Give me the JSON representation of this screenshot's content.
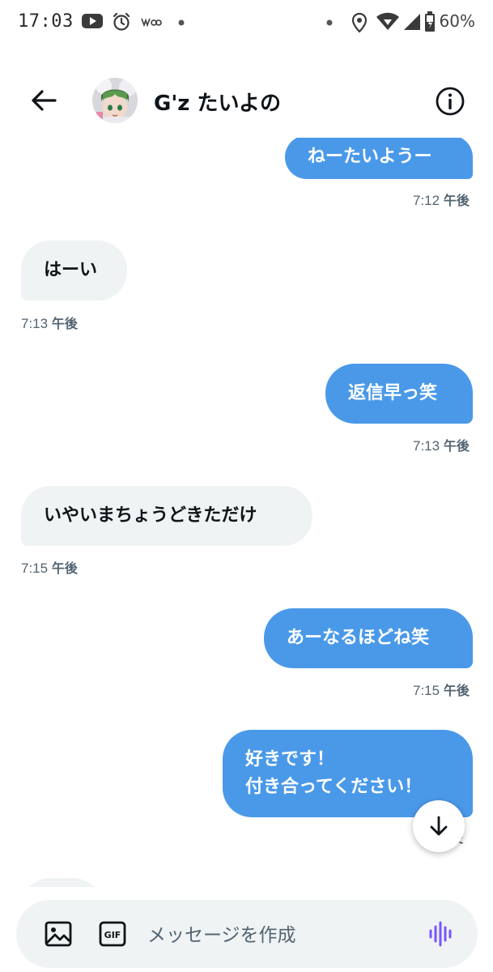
{
  "status_bar": {
    "time": "17:03",
    "battery": "60%",
    "icons": [
      "youtube-icon",
      "alarm-icon",
      "whoo-icon",
      "dot-icon",
      "dot-icon",
      "location-icon",
      "wifi-icon",
      "signal-icon",
      "battery-icon"
    ]
  },
  "header": {
    "name": "G'z たいよの",
    "back_icon": "arrow-left-icon",
    "info_icon": "info-circle-icon"
  },
  "messages": [
    {
      "direction": "sent",
      "text": "ねーたいようー",
      "time": "7:12",
      "suffix": "午後"
    },
    {
      "direction": "received",
      "text": "はーい",
      "time": "7:13",
      "suffix": "午後"
    },
    {
      "direction": "sent",
      "text": "返信早っ笑",
      "time": "7:13",
      "suffix": "午後"
    },
    {
      "direction": "received",
      "text": "いやいまちょうどきただけ",
      "time": "7:15",
      "suffix": "午後"
    },
    {
      "direction": "sent",
      "text": "あーなるほどね笑",
      "time": "7:15",
      "suffix": "午後"
    },
    {
      "direction": "sent",
      "lines": [
        "好きです！",
        "付き合ってください！"
      ],
      "time": "",
      "suffix": "後"
    }
  ],
  "composer": {
    "placeholder": "メッセージを作成",
    "gif_label": "GIF",
    "image_icon": "image-icon",
    "voice_icon": "voice-waveform-icon"
  },
  "colors": {
    "sent_bubble": "#4a99e9",
    "received_bubble": "#eff3f4",
    "timestamp": "#536471",
    "voice_accent": "#7856ff"
  }
}
